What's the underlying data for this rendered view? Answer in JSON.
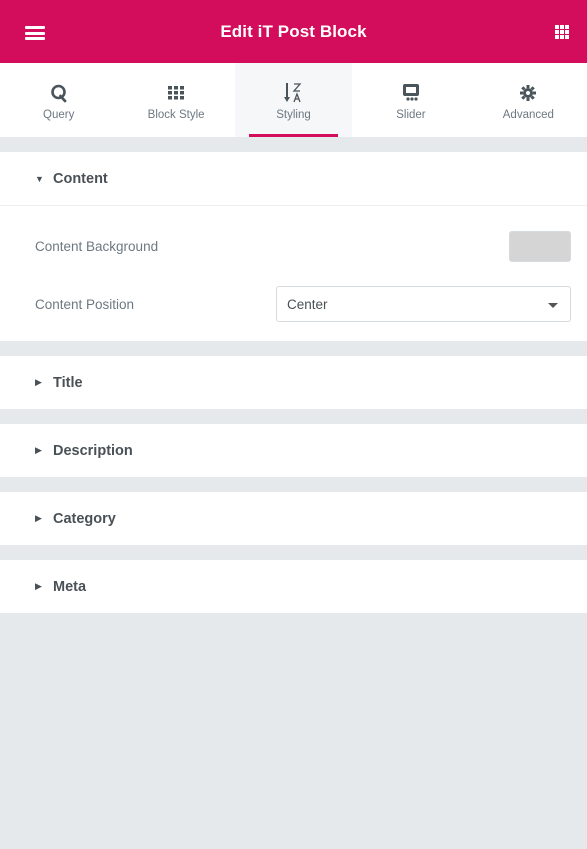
{
  "header": {
    "title": "Edit iT Post Block",
    "menu_icon": "hamburger-icon",
    "grid_icon": "apps-grid-icon",
    "bg_color": "#d30c5c"
  },
  "tabs": [
    {
      "label": "Query",
      "icon": "query-q-icon"
    },
    {
      "label": "Block Style",
      "icon": "block-grid-icon"
    },
    {
      "label": "Styling",
      "icon": "sort-z-a-icon",
      "active": true
    },
    {
      "label": "Slider",
      "icon": "slider-icon"
    },
    {
      "label": "Advanced",
      "icon": "gear-icon"
    }
  ],
  "sections": {
    "content": {
      "title": "Content",
      "background_label": "Content Background",
      "background_value": "#d5d5d5",
      "position_label": "Content Position",
      "position_value": "Center"
    },
    "title": {
      "title": "Title"
    },
    "description": {
      "title": "Description"
    },
    "category": {
      "title": "Category"
    },
    "meta": {
      "title": "Meta"
    }
  },
  "colors": {
    "accent": "#d30c5c",
    "panel_bg": "#e6e9ec",
    "text": "#495157"
  }
}
